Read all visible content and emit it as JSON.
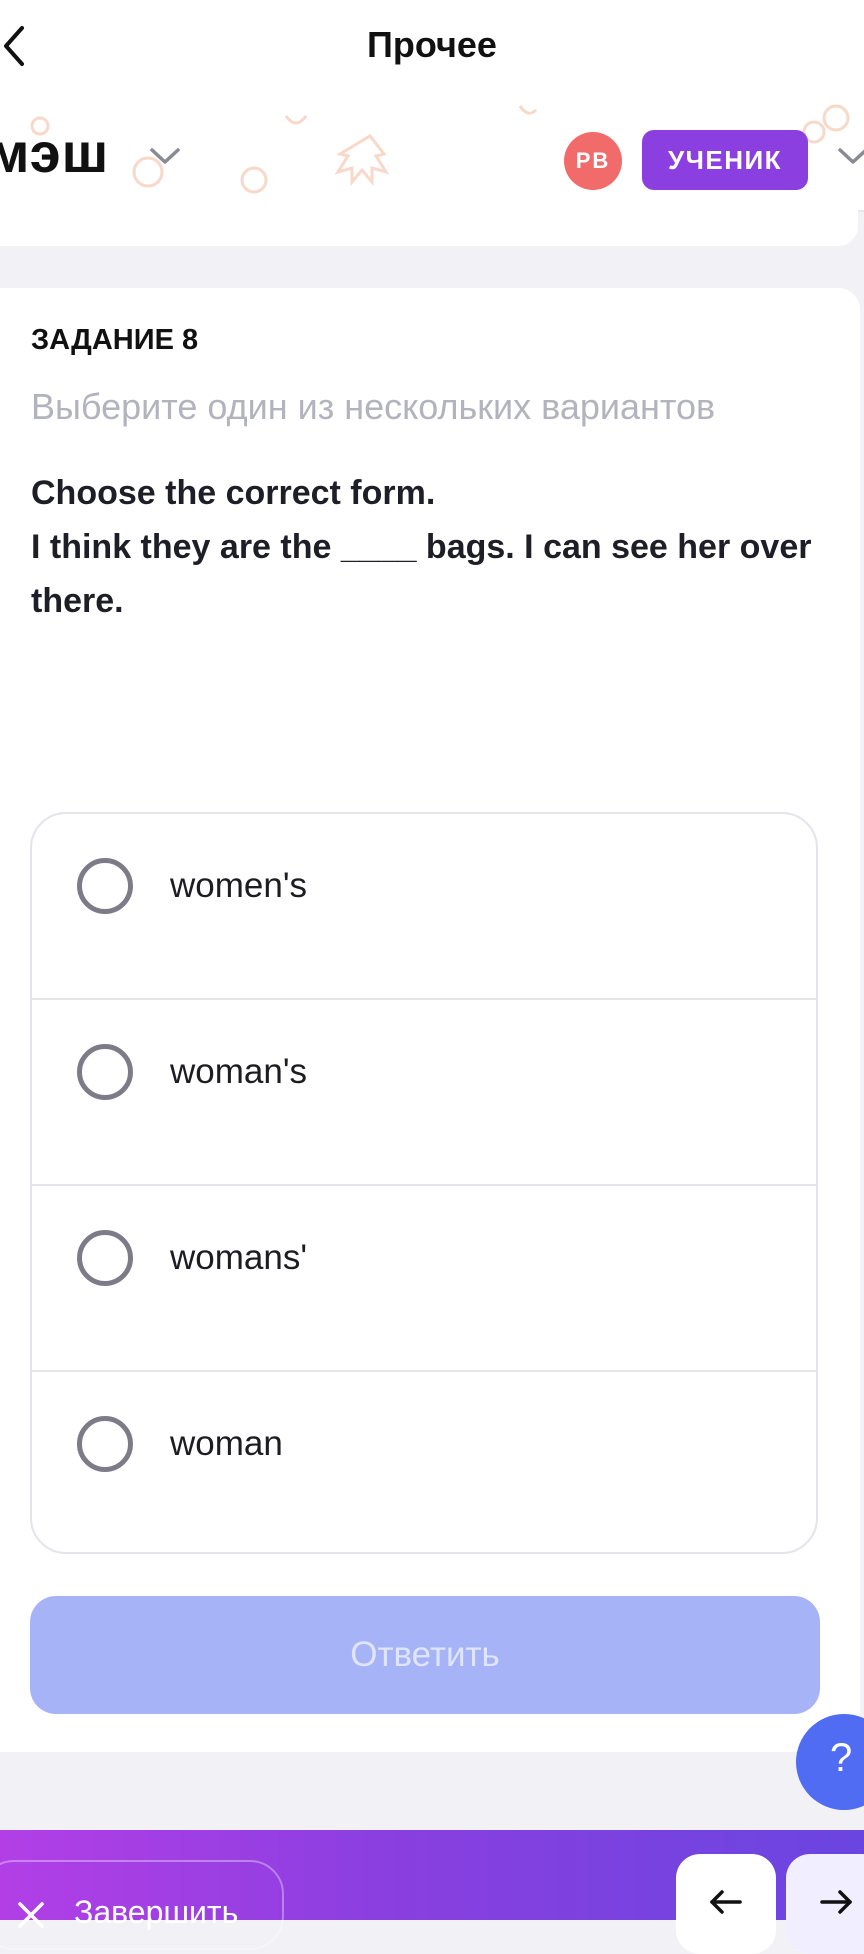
{
  "nav": {
    "title": "Прочее"
  },
  "brand": {
    "logo": "мэш",
    "avatar_initials": "РВ",
    "role": "УЧЕНИК"
  },
  "task": {
    "label": "ЗАДАНИЕ 8",
    "hint": "Выберите один из нескольких вариантов",
    "question_lines": [
      "Choose the correct form.",
      "I think they are the ____ bags. I can see her over",
      "there."
    ],
    "options": [
      "women's",
      "woman's",
      "womans'",
      "woman"
    ],
    "submit_label": "Ответить"
  },
  "help": {
    "label": "?"
  },
  "bottom": {
    "finish_label": "Завершить"
  },
  "colors": {
    "accent": "#8c3fe0",
    "avatar": "#f26b6b",
    "submit_disabled": "#a6b3f7",
    "help": "#4f6cf2"
  }
}
